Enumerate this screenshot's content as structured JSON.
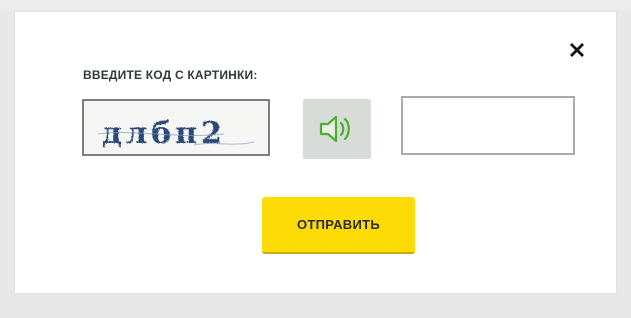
{
  "dialog": {
    "prompt": "ВВЕДИТЕ КОД С КАРТИНКИ:",
    "captcha_text": "длбп2",
    "code_input_value": "",
    "submit_label": "ОТПРАВИТЬ",
    "close_icon": "close-icon",
    "audio_icon": "speaker-icon"
  },
  "colors": {
    "submit_bg": "#fddc06",
    "audio_bg": "#d7dcd9",
    "speaker_green": "#4caf2e",
    "captcha_text": "#2c4a78"
  }
}
